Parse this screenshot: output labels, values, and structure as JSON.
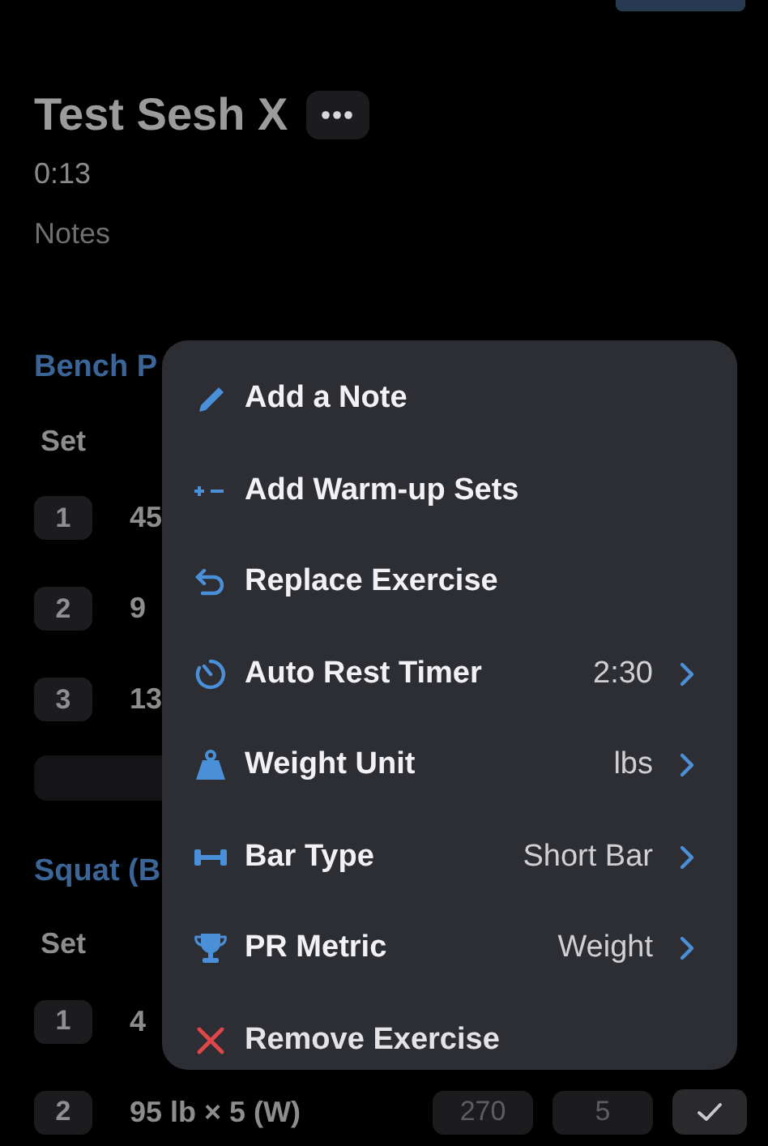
{
  "workout": {
    "title": "Test Sesh X",
    "duration": "0:13",
    "notes_label": "Notes"
  },
  "exercises": [
    {
      "name": "Bench P",
      "set_header": "Set",
      "sets": [
        {
          "number": "1",
          "previous": "45"
        },
        {
          "number": "2",
          "previous": "9"
        },
        {
          "number": "3",
          "previous": "13"
        }
      ],
      "add_set_bar": true
    },
    {
      "name": "Squat (B",
      "set_header": "Set",
      "sets": [
        {
          "number": "1",
          "previous": "4"
        },
        {
          "number": "2",
          "previous": "95 lb × 5 (W)",
          "weight": "270",
          "reps": "5",
          "check": true
        }
      ]
    }
  ],
  "menu": {
    "items": [
      {
        "kind": "action",
        "label": "Add a Note"
      },
      {
        "kind": "action",
        "label": "Add Warm-up Sets"
      },
      {
        "kind": "action",
        "label": "Replace Exercise"
      },
      {
        "kind": "setting",
        "label": "Auto Rest Timer",
        "value": "2:30"
      },
      {
        "kind": "setting",
        "label": "Weight Unit",
        "value": "lbs"
      },
      {
        "kind": "setting",
        "label": "Bar Type",
        "value": "Short Bar"
      },
      {
        "kind": "setting",
        "label": "PR Metric",
        "value": "Weight"
      },
      {
        "kind": "destructive",
        "label": "Remove Exercise"
      }
    ]
  }
}
